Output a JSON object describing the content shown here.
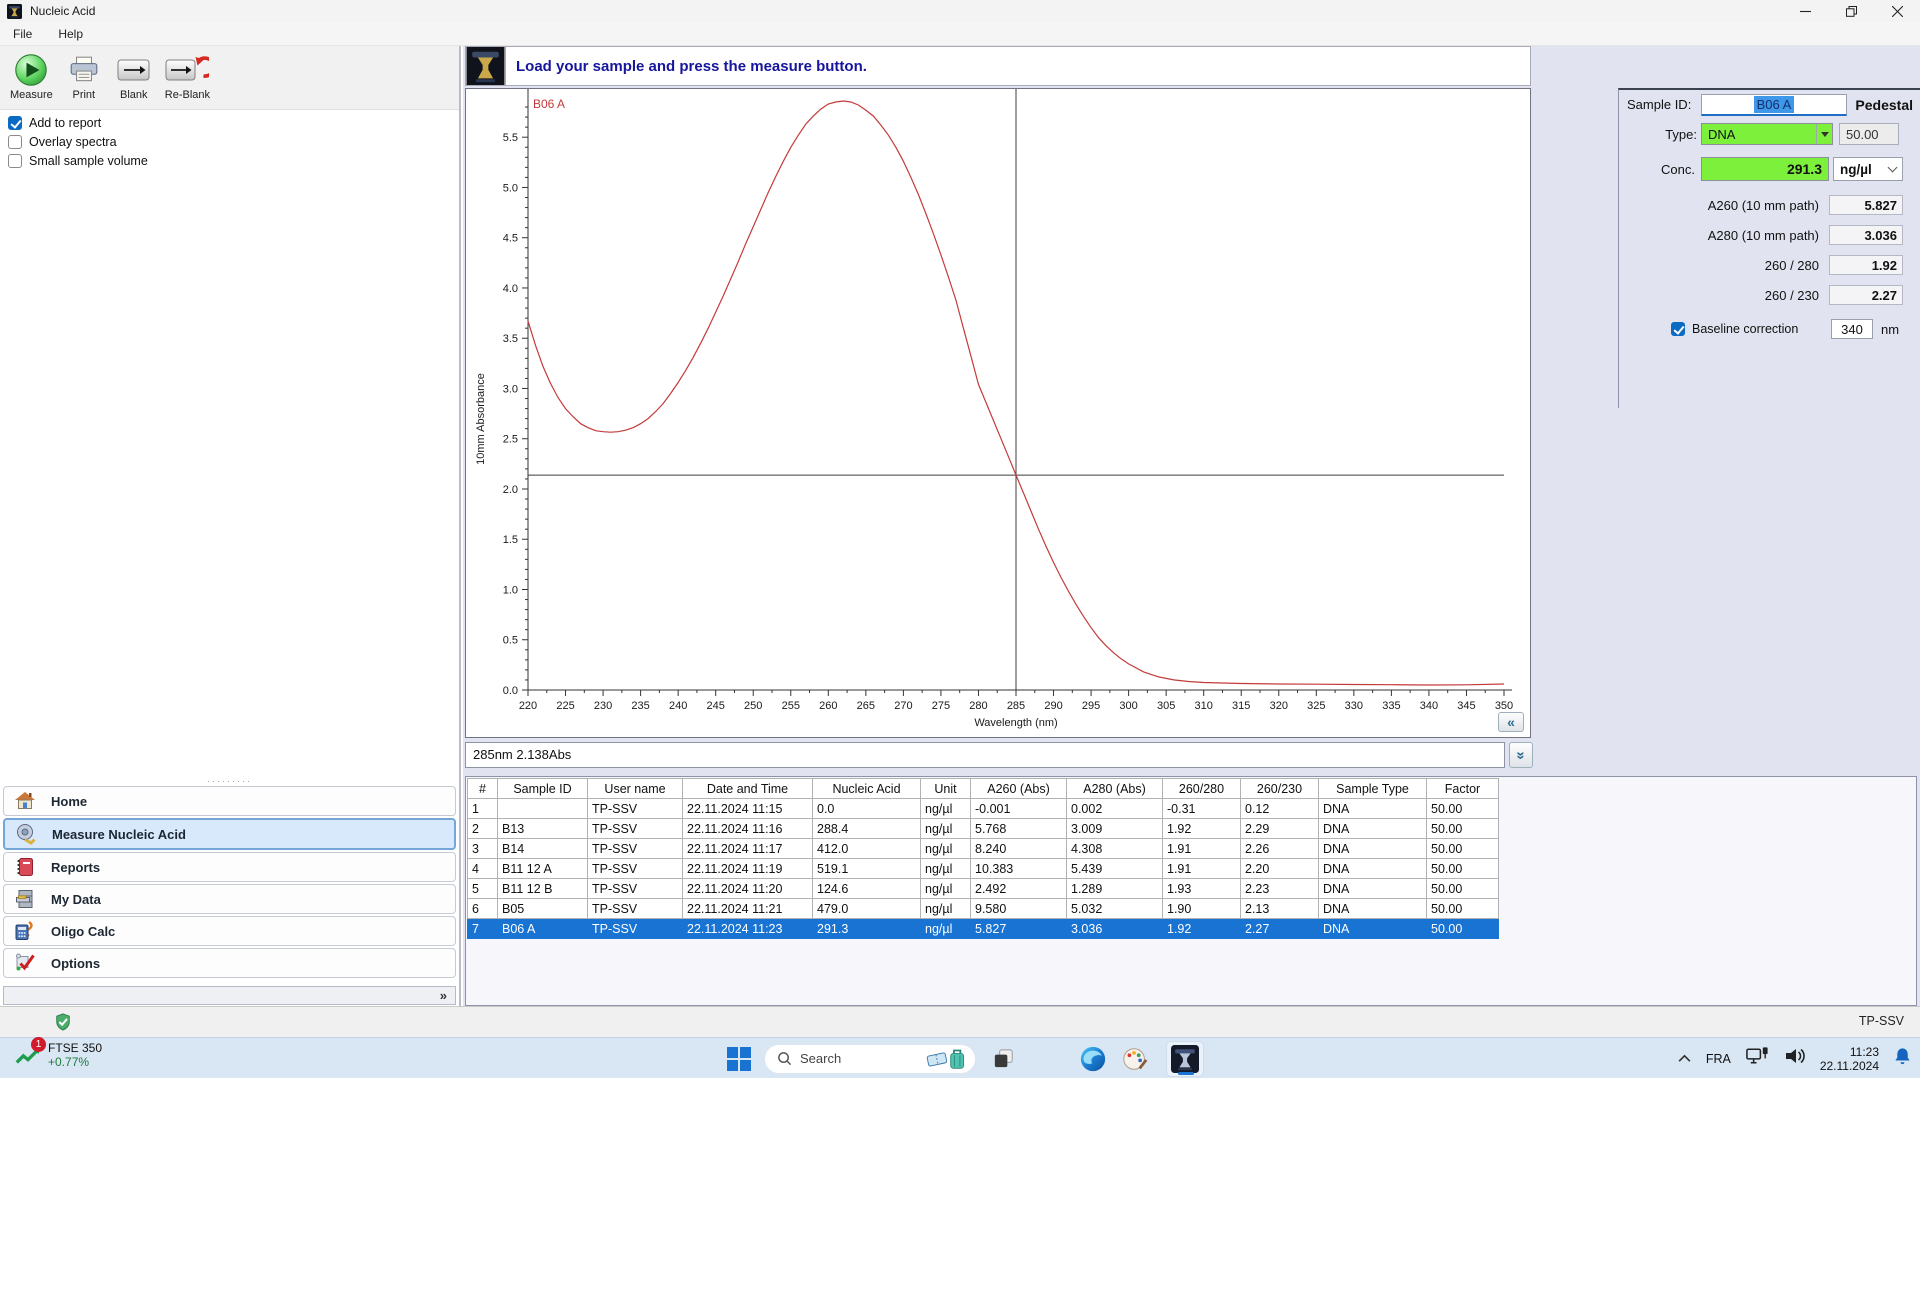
{
  "window": {
    "title": "Nucleic Acid"
  },
  "menu": {
    "items": [
      {
        "label": "File"
      },
      {
        "label": "Help"
      }
    ]
  },
  "toolbar": {
    "buttons": [
      {
        "label": "Measure"
      },
      {
        "label": "Print"
      },
      {
        "label": "Blank"
      },
      {
        "label": "Re-Blank"
      }
    ]
  },
  "options": {
    "checkboxes": [
      {
        "label": "Add to report",
        "checked": true
      },
      {
        "label": "Overlay spectra",
        "checked": false
      },
      {
        "label": "Small sample volume",
        "checked": false
      }
    ]
  },
  "instruction": {
    "text": "Load your sample and press the measure button."
  },
  "sidebar": {
    "items": [
      {
        "label": "Home",
        "selected": false
      },
      {
        "label": "Measure Nucleic Acid",
        "selected": true
      },
      {
        "label": "Reports",
        "selected": false
      },
      {
        "label": "My Data",
        "selected": false
      },
      {
        "label": "Oligo Calc",
        "selected": false
      },
      {
        "label": "Options",
        "selected": false
      }
    ],
    "expand_glyph": "»"
  },
  "chart_data": {
    "type": "line",
    "series_label": "B06 A",
    "xlabel": "Wavelength (nm)",
    "ylabel": "10mm Absorbance",
    "xlim": [
      220,
      350
    ],
    "ylim": [
      0,
      5.9
    ],
    "x_tick_step": 5,
    "y_tick_step": 0.5,
    "grid": false,
    "line_color": "#c43a3a",
    "crosshair": {
      "x_nm": 285,
      "y_abs": 2.138
    },
    "cursor_readout": "285nm 2.138Abs",
    "collapse_left_glyph": "«",
    "collapse_down_glyph": "»",
    "points": [
      [
        220,
        3.67
      ],
      [
        221,
        3.43
      ],
      [
        222,
        3.22
      ],
      [
        223,
        3.05
      ],
      [
        224,
        2.91
      ],
      [
        225,
        2.8
      ],
      [
        226,
        2.72
      ],
      [
        227,
        2.65
      ],
      [
        228,
        2.61
      ],
      [
        229,
        2.58
      ],
      [
        230,
        2.57
      ],
      [
        231,
        2.565
      ],
      [
        232,
        2.57
      ],
      [
        233,
        2.585
      ],
      [
        234,
        2.61
      ],
      [
        235,
        2.65
      ],
      [
        236,
        2.7
      ],
      [
        237,
        2.77
      ],
      [
        238,
        2.85
      ],
      [
        239,
        2.95
      ],
      [
        240,
        3.06
      ],
      [
        241,
        3.18
      ],
      [
        242,
        3.31
      ],
      [
        243,
        3.45
      ],
      [
        244,
        3.6
      ],
      [
        245,
        3.76
      ],
      [
        246,
        3.92
      ],
      [
        247,
        4.09
      ],
      [
        248,
        4.26
      ],
      [
        249,
        4.44
      ],
      [
        250,
        4.61
      ],
      [
        251,
        4.78
      ],
      [
        252,
        4.95
      ],
      [
        253,
        5.11
      ],
      [
        254,
        5.26
      ],
      [
        255,
        5.4
      ],
      [
        256,
        5.52
      ],
      [
        257,
        5.63
      ],
      [
        258,
        5.71
      ],
      [
        259,
        5.78
      ],
      [
        260,
        5.83
      ],
      [
        261,
        5.85
      ],
      [
        262,
        5.86
      ],
      [
        263,
        5.85
      ],
      [
        264,
        5.82
      ],
      [
        265,
        5.77
      ],
      [
        266,
        5.71
      ],
      [
        267,
        5.62
      ],
      [
        268,
        5.52
      ],
      [
        269,
        5.4
      ],
      [
        270,
        5.26
      ],
      [
        271,
        5.1
      ],
      [
        272,
        4.93
      ],
      [
        273,
        4.74
      ],
      [
        274,
        4.54
      ],
      [
        275,
        4.33
      ],
      [
        276,
        4.11
      ],
      [
        277,
        3.88
      ],
      [
        278,
        3.6
      ],
      [
        279,
        3.32
      ],
      [
        280,
        3.04
      ],
      [
        281,
        2.86
      ],
      [
        282,
        2.68
      ],
      [
        283,
        2.5
      ],
      [
        284,
        2.32
      ],
      [
        285,
        2.138
      ],
      [
        286,
        1.96
      ],
      [
        287,
        1.78
      ],
      [
        288,
        1.6
      ],
      [
        289,
        1.43
      ],
      [
        290,
        1.27
      ],
      [
        291,
        1.12
      ],
      [
        292,
        0.98
      ],
      [
        293,
        0.85
      ],
      [
        294,
        0.73
      ],
      [
        295,
        0.62
      ],
      [
        296,
        0.52
      ],
      [
        297,
        0.44
      ],
      [
        298,
        0.37
      ],
      [
        299,
        0.31
      ],
      [
        300,
        0.26
      ],
      [
        302,
        0.18
      ],
      [
        304,
        0.13
      ],
      [
        306,
        0.1
      ],
      [
        308,
        0.085
      ],
      [
        310,
        0.075
      ],
      [
        315,
        0.065
      ],
      [
        320,
        0.06
      ],
      [
        325,
        0.058
      ],
      [
        330,
        0.055
      ],
      [
        335,
        0.053
      ],
      [
        340,
        0.05
      ],
      [
        345,
        0.052
      ],
      [
        350,
        0.06
      ]
    ]
  },
  "side_panel": {
    "sample_id_label": "Sample ID:",
    "sample_id_value": "B06 A",
    "mode": "Pedestal",
    "type_label": "Type:",
    "type_value": "DNA",
    "factor_value": "50.00",
    "conc_label": "Conc.",
    "conc_value": "291.3",
    "conc_unit": "ng/µl",
    "rows": [
      {
        "label": "A260 (10 mm path)",
        "value": "5.827"
      },
      {
        "label": "A280 (10 mm path)",
        "value": "3.036"
      },
      {
        "label": "260 / 280",
        "value": "1.92"
      },
      {
        "label": "260 / 230",
        "value": "2.27"
      }
    ],
    "baseline": {
      "label": "Baseline correction",
      "checked": true,
      "value": "340",
      "unit": "nm"
    }
  },
  "results_table": {
    "columns": [
      "#",
      "Sample ID",
      "User name",
      "Date and Time",
      "Nucleic Acid",
      "Unit",
      "A260 (Abs)",
      "A280 (Abs)",
      "260/280",
      "260/230",
      "Sample Type",
      "Factor"
    ],
    "selected_index": 6,
    "rows": [
      [
        "1",
        "",
        "TP-SSV",
        "22.11.2024 11:15",
        "0.0",
        "ng/µl",
        "-0.001",
        "0.002",
        "-0.31",
        "0.12",
        "DNA",
        "50.00"
      ],
      [
        "2",
        "B13",
        "TP-SSV",
        "22.11.2024 11:16",
        "288.4",
        "ng/µl",
        "5.768",
        "3.009",
        "1.92",
        "2.29",
        "DNA",
        "50.00"
      ],
      [
        "3",
        "B14",
        "TP-SSV",
        "22.11.2024 11:17",
        "412.0",
        "ng/µl",
        "8.240",
        "4.308",
        "1.91",
        "2.26",
        "DNA",
        "50.00"
      ],
      [
        "4",
        "B11 12 A",
        "TP-SSV",
        "22.11.2024 11:19",
        "519.1",
        "ng/µl",
        "10.383",
        "5.439",
        "1.91",
        "2.20",
        "DNA",
        "50.00"
      ],
      [
        "5",
        "B11 12 B",
        "TP-SSV",
        "22.11.2024 11:20",
        "124.6",
        "ng/µl",
        "2.492",
        "1.289",
        "1.93",
        "2.23",
        "DNA",
        "50.00"
      ],
      [
        "6",
        "B05",
        "TP-SSV",
        "22.11.2024 11:21",
        "479.0",
        "ng/µl",
        "9.580",
        "5.032",
        "1.90",
        "2.13",
        "DNA",
        "50.00"
      ],
      [
        "7",
        "B06 A",
        "TP-SSV",
        "22.11.2024 11:23",
        "291.3",
        "ng/µl",
        "5.827",
        "3.036",
        "1.92",
        "2.27",
        "DNA",
        "50.00"
      ]
    ]
  },
  "statusbar": {
    "user": "TP-SSV"
  },
  "taskbar": {
    "widget": {
      "title": "FTSE 350",
      "change": "+0.77%",
      "badge": "1"
    },
    "search_placeholder": "Search",
    "tray": {
      "language": "FRA",
      "time": "11:23",
      "date": "22.11.2024"
    }
  },
  "colors": {
    "accent_blue": "#1873d3",
    "field_green": "#7df03c",
    "curve_red": "#c43a3a",
    "instruction_navy": "#16169c"
  }
}
